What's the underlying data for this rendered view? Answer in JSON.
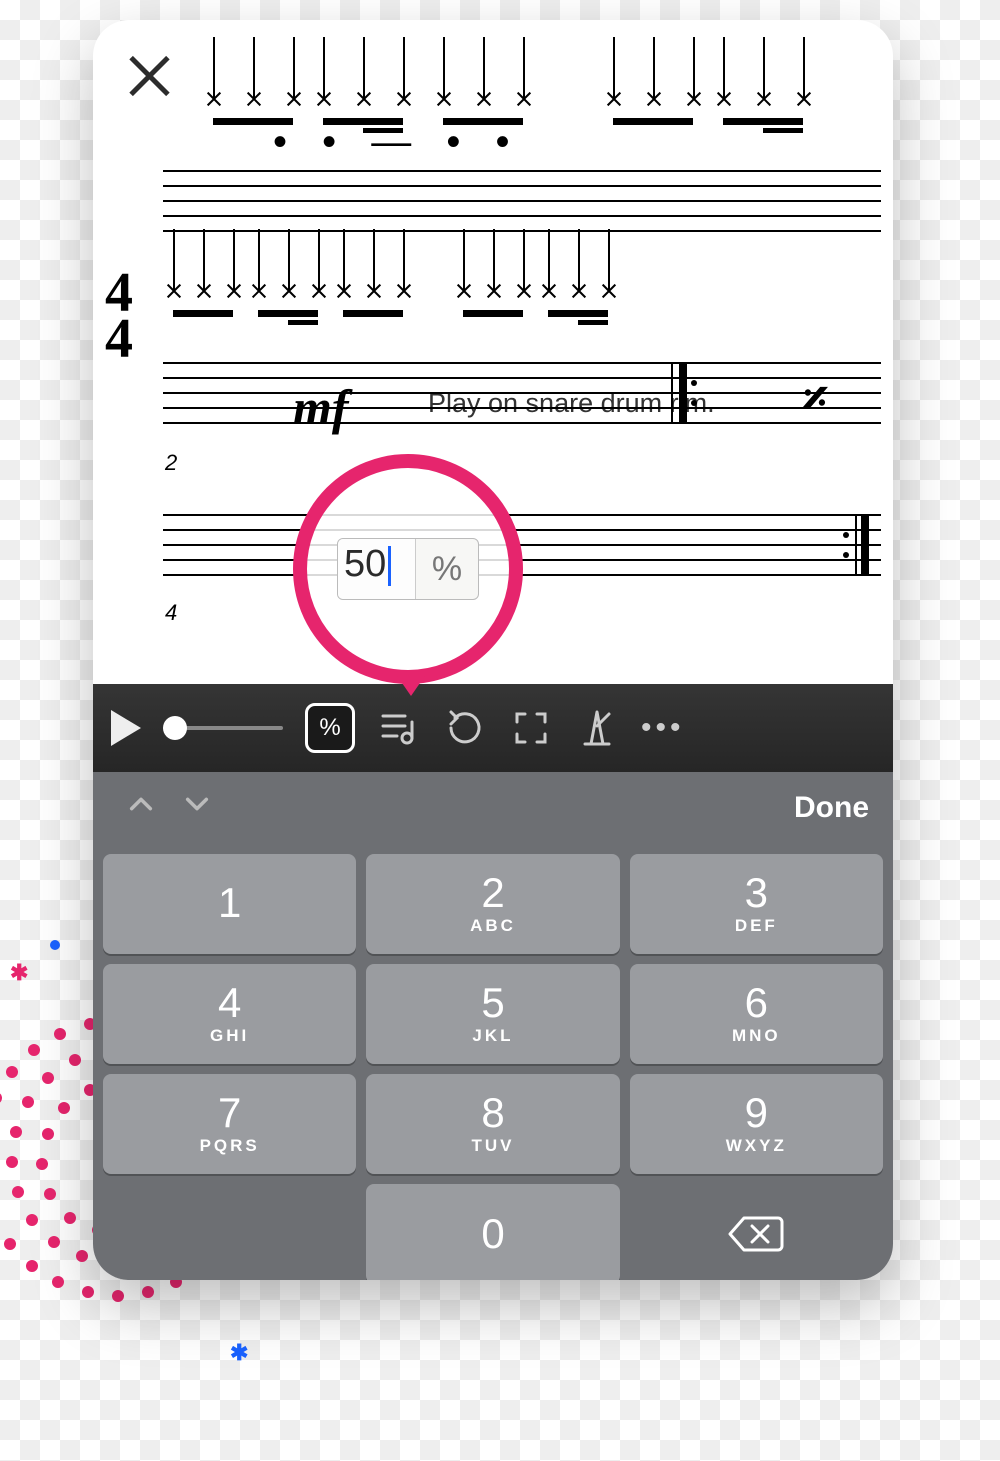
{
  "score": {
    "dynamic": "mf",
    "performance_text": "Play on snare drum rim.",
    "time_signature_top": "4",
    "time_signature_bottom": "4",
    "measure_numbers": [
      "2",
      "4"
    ]
  },
  "tempo_popover": {
    "value": "50",
    "unit": "%"
  },
  "toolbar": {
    "percent_label": "%"
  },
  "keyboard_accessory": {
    "done_label": "Done"
  },
  "numpad": [
    {
      "num": "1",
      "letters": ""
    },
    {
      "num": "2",
      "letters": "ABC"
    },
    {
      "num": "3",
      "letters": "DEF"
    },
    {
      "num": "4",
      "letters": "GHI"
    },
    {
      "num": "5",
      "letters": "JKL"
    },
    {
      "num": "6",
      "letters": "MNO"
    },
    {
      "num": "7",
      "letters": "PQRS"
    },
    {
      "num": "8",
      "letters": "TUV"
    },
    {
      "num": "9",
      "letters": "WXYZ"
    },
    {
      "num": "",
      "letters": ""
    },
    {
      "num": "0",
      "letters": ""
    },
    {
      "num": "",
      "letters": ""
    }
  ]
}
